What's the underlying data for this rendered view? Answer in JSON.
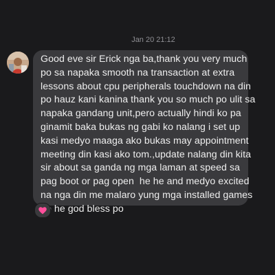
{
  "conversation": {
    "timestamp": "Jan 20 21:12",
    "message": {
      "text": "Good eve sir Erick nga ba,thank you very much\npo sa napaka smooth na transaction at extra\nlessons about cpu peripherals touchdown na din\npo hauz kani kanina thank you so much po ulit sa\nnapaka gandang unit,pero actually hindi ko pa\nginamit baka bukas ng gabi ko nalang i set up\nkasi medyo maaga ako bukas may appointment\nmeeting din kasi ako tom.,update nalang din kita\nsir about sa ganda ng mga laman at speed sa\npag boot or pag open  he he and medyo excited\nna nga din me malaro yung mga installed games\nhe he god bless po",
      "reaction": "heart-icon"
    },
    "avatar": "avatar-image"
  },
  "colors": {
    "background": "#1a1a1c",
    "bubble": "#3a3a3d",
    "text": "#eeeeee",
    "timestamp": "#8e8e93",
    "reaction": "#ff4f9b"
  }
}
